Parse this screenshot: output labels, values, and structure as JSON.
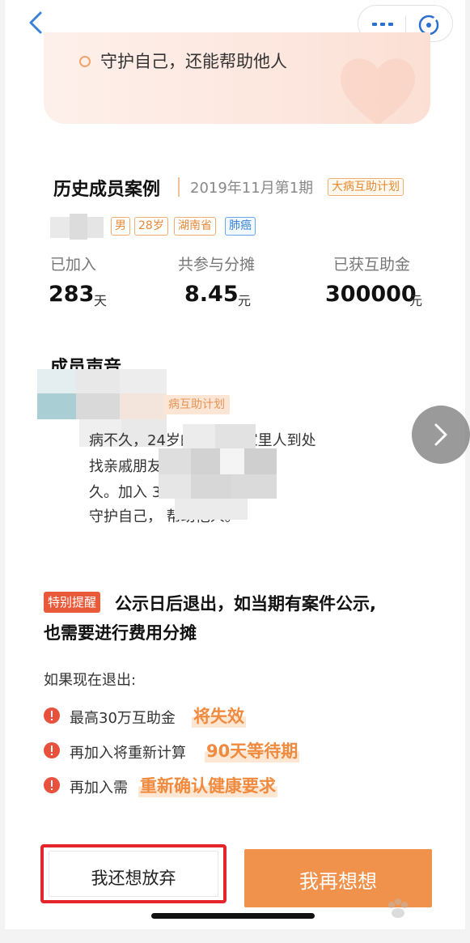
{
  "nav": {
    "back_icon": "chevron-left-icon",
    "more_icon": "more-dots-icon",
    "close_icon": "close-circle-icon"
  },
  "top_card": {
    "bullet_text": "守护自己，还能帮助他人"
  },
  "history": {
    "title": "历史成员案例",
    "date": "2019年11月第1期",
    "plan_tag": "大病互助计划",
    "tags": [
      "男",
      "28岁",
      "湖南省",
      "肺癌"
    ],
    "stats": [
      {
        "label": "已加入",
        "value": "283",
        "unit": "天"
      },
      {
        "label": "共参与分摊",
        "value": "8.45",
        "unit": "元"
      },
      {
        "label": "已获互助金",
        "value": "300000",
        "unit": "元"
      }
    ]
  },
  "voice": {
    "title": "成员声音",
    "plan_tag": "病互助计划",
    "lines": [
      "病不久，24岁的    住院，家里人到处",
      "找亲戚朋友        的钱不知能撑多",
      "久。加入          30万的大病保障。",
      "守护自己，        帮助他人。"
    ]
  },
  "reminder": {
    "badge": "特别提醒",
    "line1": "公示日后退出，如当期有案件公示,",
    "line2": "也需要进行费用分摊",
    "if_quit": "如果现在退出:",
    "items": [
      {
        "text": "最高30万互助金",
        "highlight": "将失效"
      },
      {
        "text": "再加入将重新计算",
        "highlight": "90天等待期"
      },
      {
        "text": "再加入需",
        "highlight": "重新确认健康要求"
      }
    ]
  },
  "buttons": {
    "quit": "我还想放弃",
    "rethink": "我再想想"
  },
  "colors": {
    "accent": "#f0924b",
    "warn": "#e8523c",
    "highlight_box": "#e5252c"
  }
}
